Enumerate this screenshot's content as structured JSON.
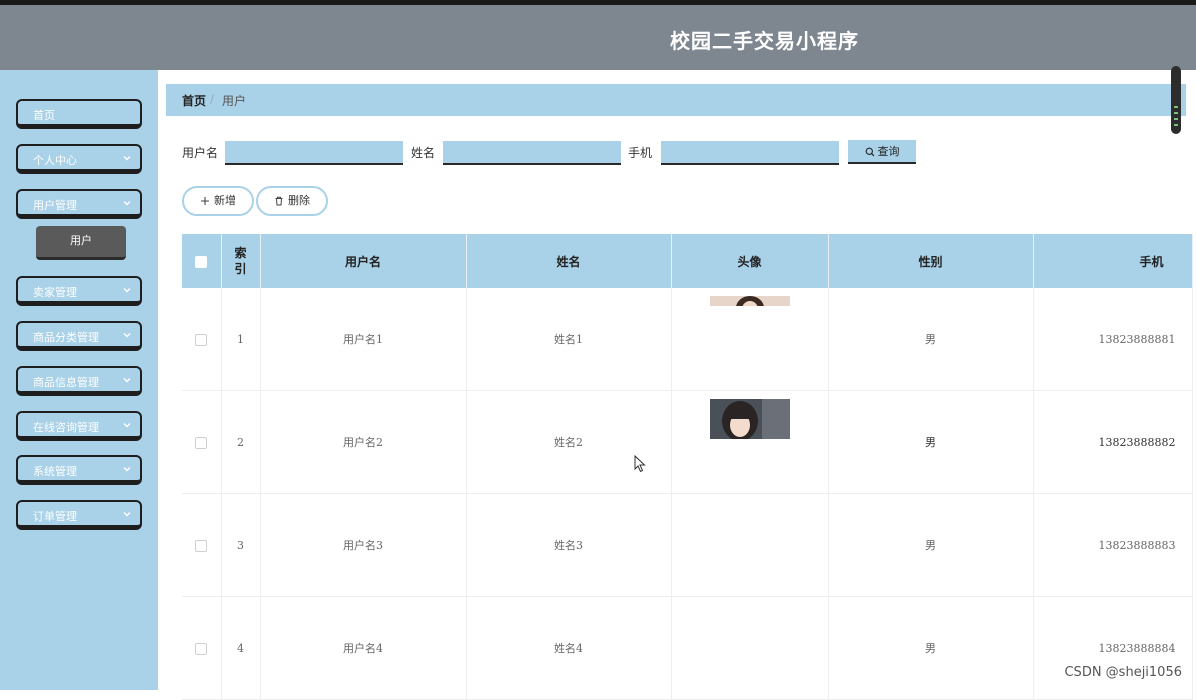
{
  "header": {
    "title": "校园二手交易小程序"
  },
  "sidebar": {
    "items": [
      {
        "label": "首页"
      },
      {
        "label": "个人中心"
      },
      {
        "label": "用户管理"
      },
      {
        "label": "卖家管理"
      },
      {
        "label": "商品分类管理"
      },
      {
        "label": "商品信息管理"
      },
      {
        "label": "在线咨询管理"
      },
      {
        "label": "系统管理"
      },
      {
        "label": "订单管理"
      }
    ],
    "active_sub": "用户"
  },
  "breadcrumb": {
    "home": "首页",
    "separator": "/",
    "current": "用户"
  },
  "search": {
    "username_label": "用户名",
    "name_label": "姓名",
    "phone_label": "手机",
    "query_button": "查询"
  },
  "actions": {
    "add": "新增",
    "delete": "删除"
  },
  "table": {
    "headers": {
      "index": "索引",
      "username": "用户名",
      "name": "姓名",
      "avatar": "头像",
      "gender": "性别",
      "phone": "手机"
    },
    "rows": [
      {
        "index": "1",
        "username": "用户名1",
        "name": "姓名1",
        "gender": "男",
        "phone": "13823888881"
      },
      {
        "index": "2",
        "username": "用户名2",
        "name": "姓名2",
        "gender": "男",
        "phone": "13823888882"
      },
      {
        "index": "3",
        "username": "用户名3",
        "name": "姓名3",
        "gender": "男",
        "phone": "13823888883"
      },
      {
        "index": "4",
        "username": "用户名4",
        "name": "姓名4",
        "gender": "男",
        "phone": "13823888884"
      }
    ]
  },
  "watermark": "CSDN @sheji1056",
  "colors": {
    "accent": "#a9d1e8",
    "topbar": "#7e8790",
    "sub_active": "#5a5a5a"
  }
}
